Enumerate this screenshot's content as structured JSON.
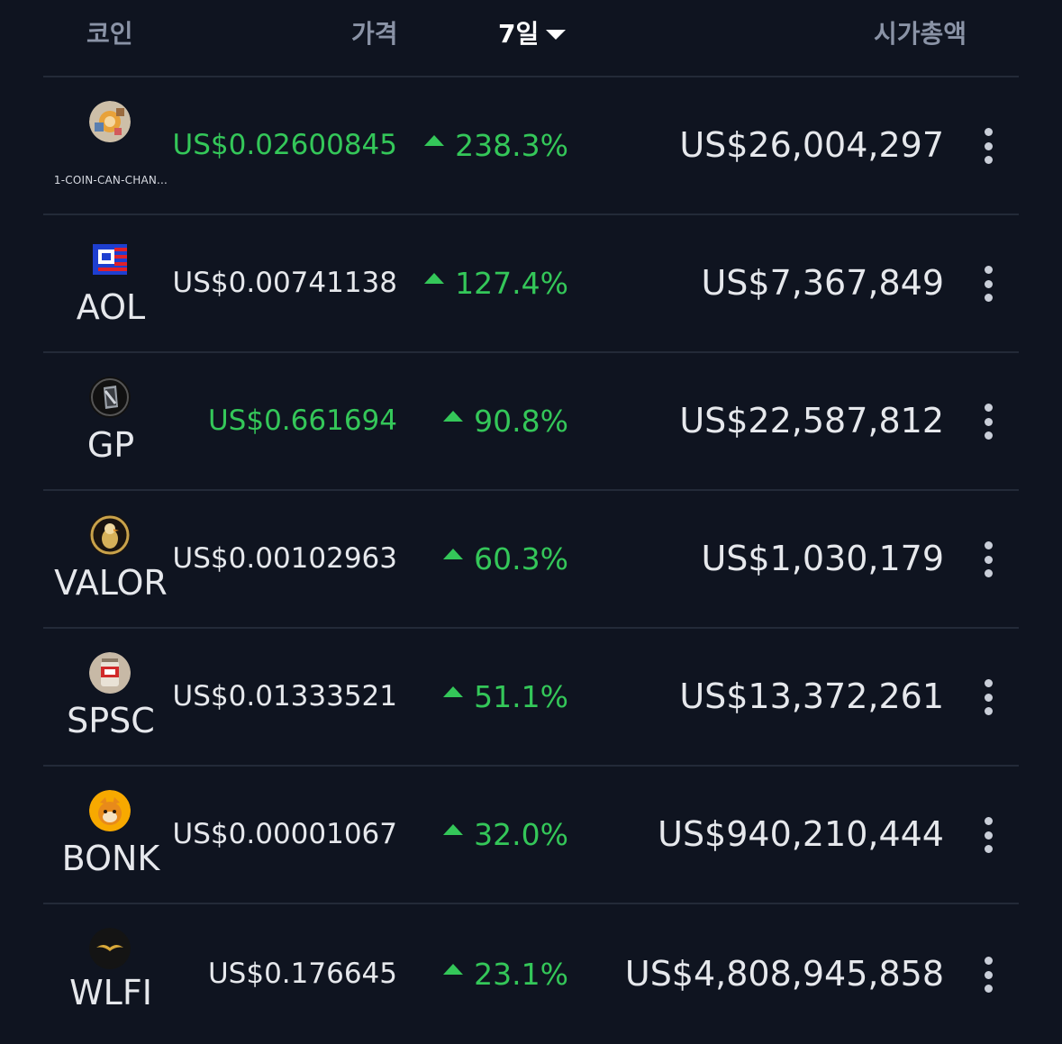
{
  "header": {
    "coin": "코인",
    "price": "가격",
    "week": "7일",
    "market_cap": "시가총액"
  },
  "rows": [
    {
      "symbol": "1-COIN-CAN-CHAN...",
      "price": "US$0.02600845",
      "change": "238.3%",
      "market_cap": "US$26,004,297"
    },
    {
      "symbol": "AOL",
      "price": "US$0.00741138",
      "change": "127.4%",
      "market_cap": "US$7,367,849"
    },
    {
      "symbol": "GP",
      "price": "US$0.661694",
      "change": "90.8%",
      "market_cap": "US$22,587,812"
    },
    {
      "symbol": "VALOR",
      "price": "US$0.00102963",
      "change": "60.3%",
      "market_cap": "US$1,030,179"
    },
    {
      "symbol": "SPSC",
      "price": "US$0.01333521",
      "change": "51.1%",
      "market_cap": "US$13,372,261"
    },
    {
      "symbol": "BONK",
      "price": "US$0.00001067",
      "change": "32.0%",
      "market_cap": "US$940,210,444"
    },
    {
      "symbol": "WLFI",
      "price": "US$0.176645",
      "change": "23.1%",
      "market_cap": "US$4,808,945,858"
    }
  ],
  "colors": {
    "background": "#0f1420",
    "positive": "#34c759",
    "header_text": "#8a93a6",
    "divider": "#232a38"
  },
  "icons": [
    "sort-desc-icon",
    "arrow-up-icon",
    "more-vertical-icon"
  ]
}
